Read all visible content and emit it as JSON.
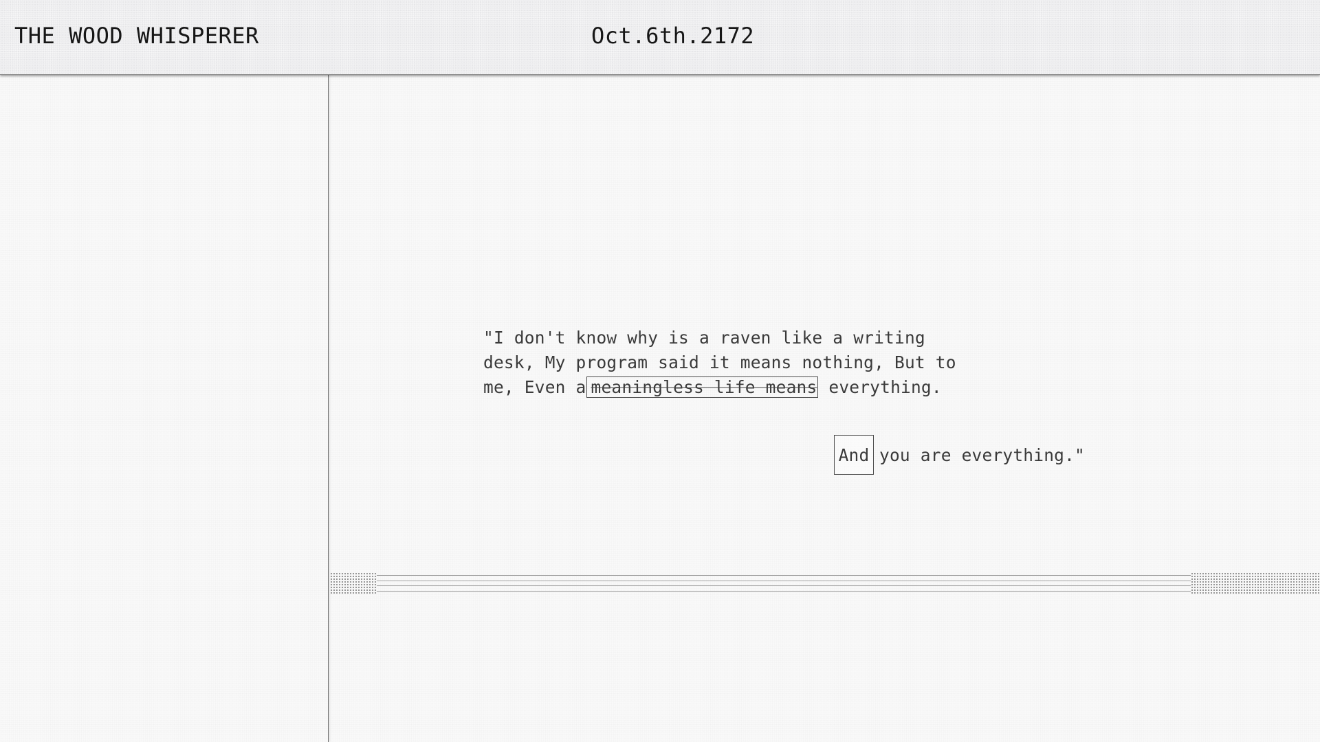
{
  "header": {
    "title": "THE WOOD WHISPERER",
    "date": "Oct.6th.2172"
  },
  "dialogue": {
    "quote_before": "\"I don't know why is a raven like a writing desk, My program said it means nothing, But to me, Even a",
    "quote_highlight": "meaningless life means",
    "quote_after": " everything.",
    "answer_keyword": "And",
    "answer_rest": "you are everything.\""
  },
  "colors": {
    "header_bg": "#ececee",
    "page_bg": "#f9f9f9",
    "text": "#1c1c1c",
    "border": "#4a4a4a"
  },
  "icons": {
    "divider_pattern": "dotted-pattern-icon"
  }
}
